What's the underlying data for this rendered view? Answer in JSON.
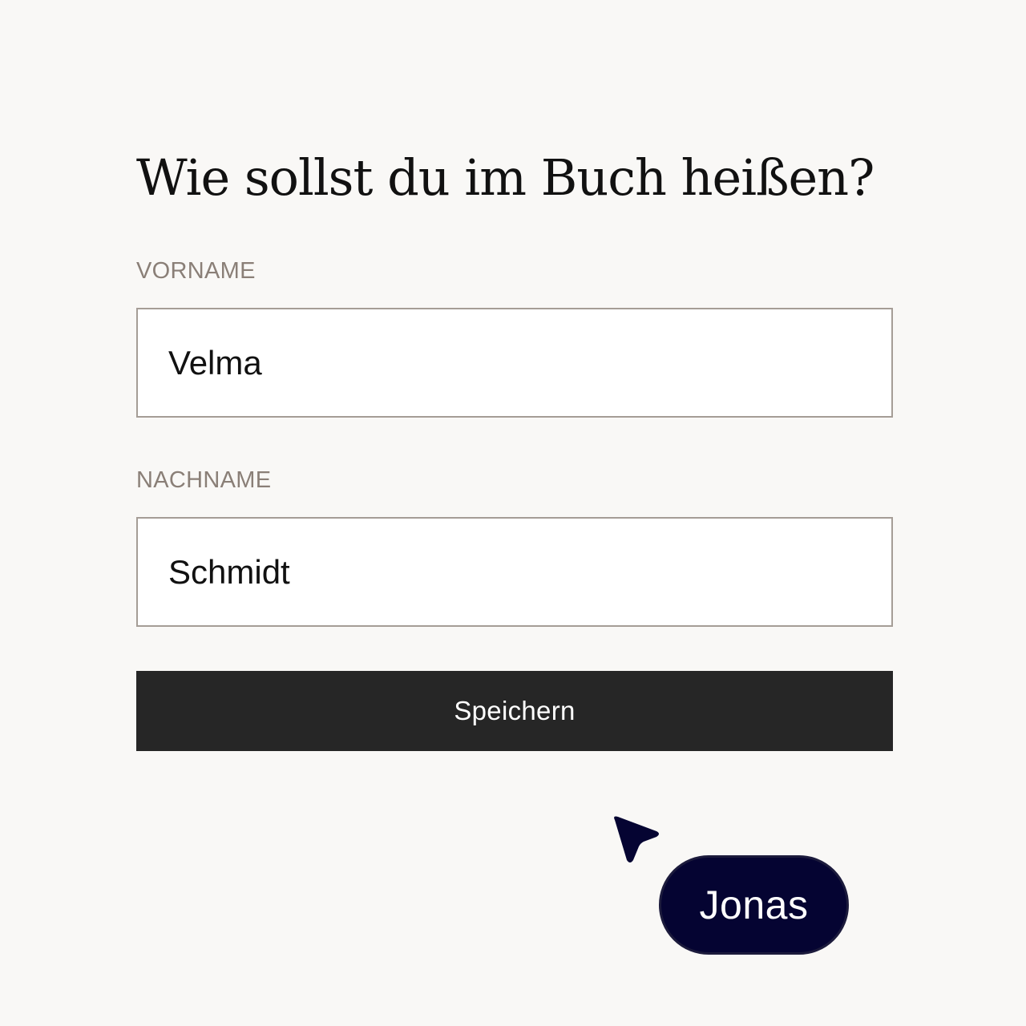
{
  "form": {
    "title": "Wie sollst du im Buch heißen?",
    "first_name": {
      "label": "VORNAME",
      "value": "Velma"
    },
    "last_name": {
      "label": "NACHNAME",
      "value": "Schmidt"
    },
    "save_label": "Speichern"
  },
  "collaborator_cursor": {
    "name": "Jonas",
    "icon": "cursor-arrow-icon",
    "color": "#050432"
  },
  "colors": {
    "background": "#f9f8f6",
    "label": "#8a7f77",
    "input_border": "#a59d96",
    "button": "#262626"
  }
}
